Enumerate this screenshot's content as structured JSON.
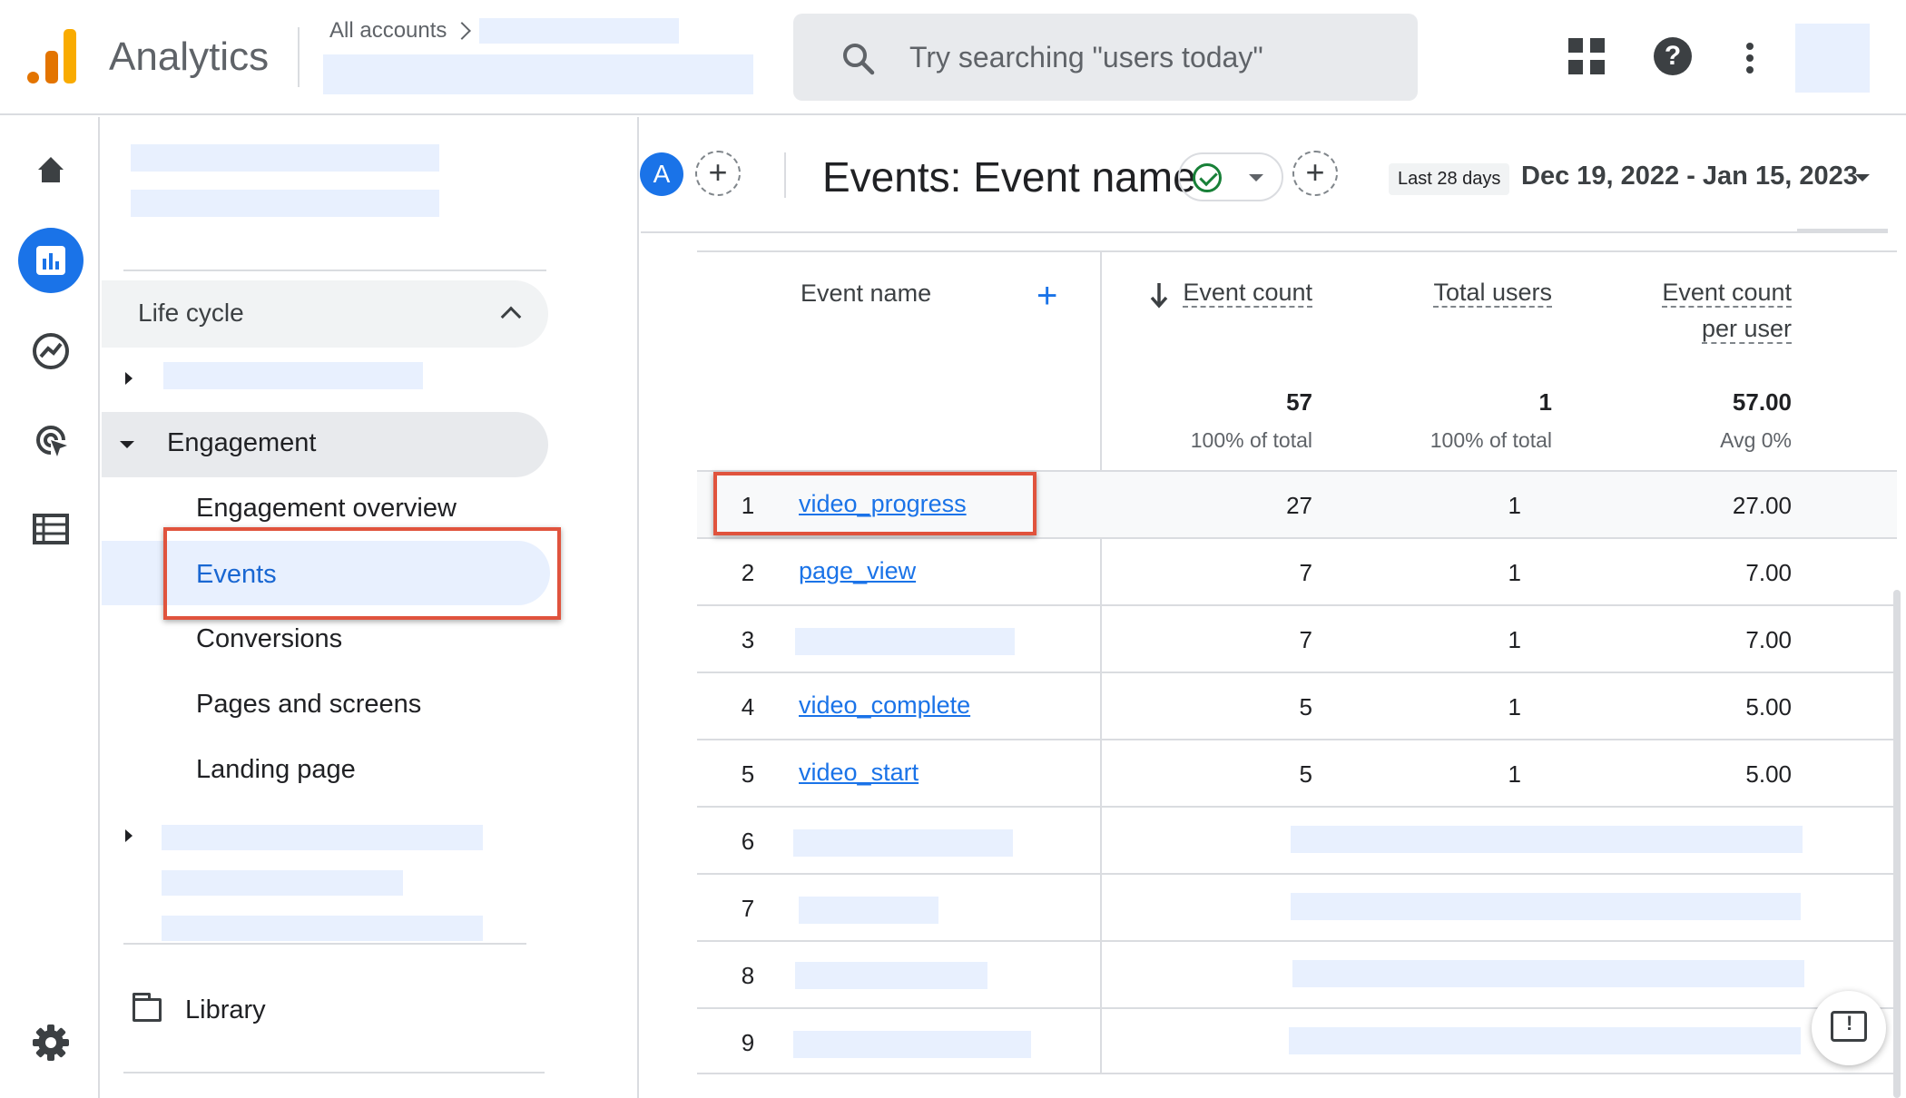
{
  "app": {
    "title": "Analytics",
    "breadcrumb": "All accounts"
  },
  "search": {
    "placeholder": "Try searching \"users today\""
  },
  "icons": {
    "logo": "analytics-logo",
    "search": "search-icon",
    "apps": "apps-grid-icon",
    "help": "help-icon",
    "more": "more-vert-icon",
    "home": "home-icon",
    "reports": "reports-icon",
    "explore": "explore-icon",
    "advertising": "advertising-icon",
    "configure": "configure-icon",
    "settings": "gear-icon",
    "library": "folder-icon",
    "feedback": "feedback-icon"
  },
  "colors": {
    "accent": "#1a73e8",
    "selected_bg": "#e8f0fe",
    "highlight": "#e0533d",
    "logo_orange": "#e37400",
    "logo_yellow": "#f9ab00"
  },
  "nav": {
    "section": "Life cycle",
    "group": "Engagement",
    "items": [
      "Engagement overview",
      "Events",
      "Conversions",
      "Pages and screens",
      "Landing page"
    ],
    "library": "Library"
  },
  "report": {
    "segment_letter": "A",
    "title": "Events: Event name",
    "date_chip": "Last 28 days",
    "date_range": "Dec 19, 2022 - Jan 15, 2023"
  },
  "table": {
    "dim_header": "Event name",
    "col_event_count": "Event count",
    "col_total_users": "Total users",
    "col_per_user_line1": "Event count",
    "col_per_user_line2": "per user",
    "totals": {
      "event_count": "57",
      "event_count_sub": "100% of total",
      "total_users": "1",
      "total_users_sub": "100% of total",
      "per_user": "57.00",
      "per_user_sub": "Avg 0%"
    },
    "rows": [
      {
        "rank": "1",
        "name": "video_progress",
        "event_count": "27",
        "total_users": "1",
        "per_user": "27.00"
      },
      {
        "rank": "2",
        "name": "page_view",
        "event_count": "7",
        "total_users": "1",
        "per_user": "7.00"
      },
      {
        "rank": "3",
        "name": "",
        "event_count": "7",
        "total_users": "1",
        "per_user": "7.00"
      },
      {
        "rank": "4",
        "name": "video_complete",
        "event_count": "5",
        "total_users": "1",
        "per_user": "5.00"
      },
      {
        "rank": "5",
        "name": "video_start",
        "event_count": "5",
        "total_users": "1",
        "per_user": "5.00"
      },
      {
        "rank": "6"
      },
      {
        "rank": "7"
      },
      {
        "rank": "8"
      },
      {
        "rank": "9"
      }
    ]
  }
}
